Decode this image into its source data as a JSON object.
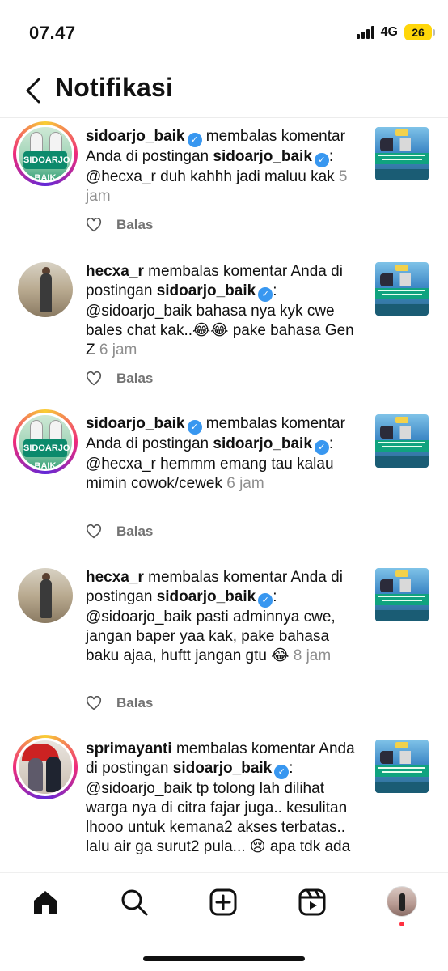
{
  "status_bar": {
    "time": "07.47",
    "network": "4G",
    "battery": "26"
  },
  "header": {
    "title": "Notifikasi",
    "back_icon": "chevron-left-icon"
  },
  "notifications": [
    {
      "username": "sidoarjo_baik",
      "verified": true,
      "action": "membalas komentar Anda di postingan",
      "post_owner": "sidoarjo_baik",
      "text": ": @hecxa_r duh kahhh jadi maluu kak",
      "time": "5 jam",
      "reply_label": "Balas",
      "avatar_badge": "SIDOARJO BAIK"
    },
    {
      "username": "hecxa_r",
      "verified": false,
      "action": "membalas komentar Anda di postingan",
      "post_owner": "sidoarjo_baik",
      "text": ": @sidoarjo_baik bahasa nya kyk cwe bales chat kak..😂😂 pake bahasa Gen Z",
      "time": "6 jam",
      "reply_label": "Balas"
    },
    {
      "username": "sidoarjo_baik",
      "verified": true,
      "action": "membalas komentar Anda di postingan",
      "post_owner": "sidoarjo_baik",
      "text": ": @hecxa_r hemmm emang tau kalau mimin cowok/cewek",
      "time": "6 jam",
      "reply_label": "Balas",
      "avatar_badge": "SIDOARJO BAIK"
    },
    {
      "username": "hecxa_r",
      "verified": false,
      "action": "membalas komentar Anda di postingan",
      "post_owner": "sidoarjo_baik",
      "text": ": @sidoarjo_baik pasti adminnya cwe, jangan baper yaa kak, pake bahasa baku ajaa, huftt jangan gtu 😂",
      "time": "8 jam",
      "reply_label": "Balas"
    },
    {
      "username": "sprimayanti",
      "verified": false,
      "action": "membalas komentar Anda di postingan",
      "post_owner": "sidoarjo_baik",
      "text": ": @sidoarjo_baik tp tolong lah dilihat warga nya di citra fajar juga.. kesulitan lhooo untuk kemana2 akses terbatas.. lalu air ga surut2 pula... 😢 apa tdk ada",
      "time": "",
      "reply_label": ""
    }
  ],
  "icons": {
    "verified": "verified-badge-icon",
    "heart": "heart-icon",
    "home": "home-icon",
    "search": "search-icon",
    "create": "plus-square-icon",
    "reels": "reels-icon",
    "profile": "profile-avatar"
  },
  "colors": {
    "verified": "#3897f0",
    "muted": "#8e8e8e",
    "notification_dot": "#ff3040",
    "battery": "#ffd60a"
  }
}
